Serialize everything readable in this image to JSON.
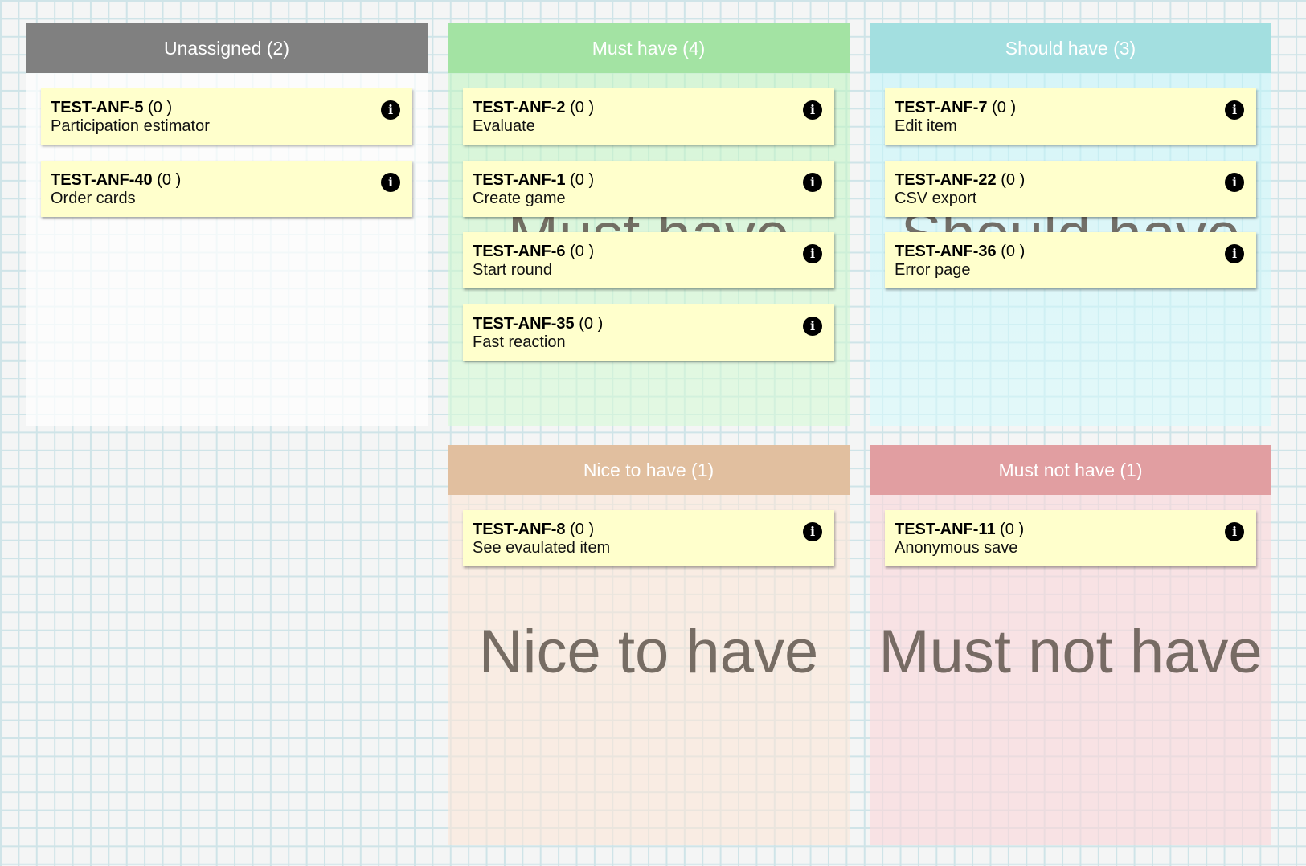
{
  "columns": {
    "unassigned": {
      "header": "Unassigned (2)",
      "watermark": "",
      "color": "#808080",
      "cards": [
        {
          "key": "TEST-ANF-5",
          "estimate": "(0 )",
          "title": "Participation estimator",
          "icon": "info-icon"
        },
        {
          "key": "TEST-ANF-40",
          "estimate": "(0 )",
          "title": "Order cards",
          "icon": "info-icon"
        }
      ]
    },
    "must": {
      "header": "Must have (4)",
      "watermark": "Must have",
      "color": "#a3e3a3",
      "cards": [
        {
          "key": "TEST-ANF-2",
          "estimate": "(0 )",
          "title": "Evaluate",
          "icon": "info-icon"
        },
        {
          "key": "TEST-ANF-1",
          "estimate": "(0 )",
          "title": "Create game",
          "icon": "info-icon"
        },
        {
          "key": "TEST-ANF-6",
          "estimate": "(0 )",
          "title": "Start round",
          "icon": "info-icon"
        },
        {
          "key": "TEST-ANF-35",
          "estimate": "(0 )",
          "title": "Fast reaction",
          "icon": "info-icon"
        }
      ]
    },
    "should": {
      "header": "Should have (3)",
      "watermark": "Should have",
      "color": "#a3dfe0",
      "cards": [
        {
          "key": "TEST-ANF-7",
          "estimate": "(0 )",
          "title": "Edit item",
          "icon": "info-icon"
        },
        {
          "key": "TEST-ANF-22",
          "estimate": "(0 )",
          "title": "CSV export",
          "icon": "info-icon"
        },
        {
          "key": "TEST-ANF-36",
          "estimate": "(0 )",
          "title": "Error page",
          "icon": "info-icon"
        }
      ]
    },
    "nice": {
      "header": "Nice to have (1)",
      "watermark": "Nice to have",
      "color": "#e1bf9f",
      "cards": [
        {
          "key": "TEST-ANF-8",
          "estimate": "(0 )",
          "title": "See evaulated item",
          "icon": "info-icon"
        }
      ]
    },
    "mustnot": {
      "header": "Must not have (1)",
      "watermark": "Must not have",
      "color": "#e19ea1",
      "cards": [
        {
          "key": "TEST-ANF-11",
          "estimate": "(0 )",
          "title": "Anonymous save",
          "icon": "info-icon"
        }
      ]
    }
  }
}
